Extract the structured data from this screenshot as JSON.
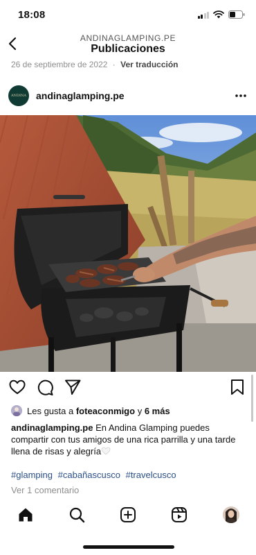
{
  "status_bar": {
    "time": "18:08"
  },
  "header": {
    "account": "ANDINAGLAMPING.PE",
    "title": "Publicaciones"
  },
  "previous_post": {
    "date": "26 de septiembre de 2022",
    "separator": "·",
    "translate_label": "Ver traducción"
  },
  "post": {
    "username": "andinaglamping.pe",
    "avatar_text": "ANDINA",
    "likes": {
      "prefix": "Les gusta a",
      "user": "foteaconmigo",
      "connector": "y",
      "others": "6 más"
    },
    "caption": {
      "username": "andinaglamping.pe",
      "text": "En Andina Glamping puedes compartir con tus amigos de una rica parrilla y una tarde llena de risas y alegría"
    },
    "hashtags": [
      "#glamping",
      "#cabañascusco",
      "#travelcusco"
    ],
    "comments_label": "Ver 1 comentario"
  },
  "icons": {
    "back": "chevron-left-icon",
    "more": "more-horizontal-icon",
    "like": "heart-icon",
    "comment": "comment-icon",
    "share": "paper-plane-icon",
    "save": "bookmark-icon",
    "tabs": [
      "home-icon",
      "search-icon",
      "create-icon",
      "reels-icon",
      "profile-avatar"
    ]
  }
}
